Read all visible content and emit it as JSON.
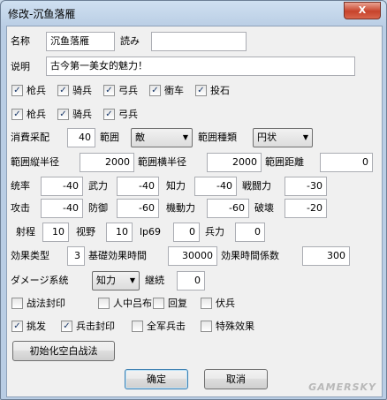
{
  "window": {
    "title": "修改-沉鱼落雁",
    "close_glyph": "X"
  },
  "name": {
    "label": "名称",
    "value": "沉鱼落雁",
    "reading_label": "読み",
    "reading_value": ""
  },
  "desc": {
    "label": "说明",
    "value": "古今第一美女的魅力！"
  },
  "unit_row1": [
    {
      "label": "枪兵",
      "checked": true
    },
    {
      "label": "骑兵",
      "checked": true
    },
    {
      "label": "弓兵",
      "checked": true
    },
    {
      "label": "衝车",
      "checked": true
    },
    {
      "label": "投石",
      "checked": true
    }
  ],
  "unit_row2": [
    {
      "label": "枪兵",
      "checked": true
    },
    {
      "label": "骑兵",
      "checked": true
    },
    {
      "label": "弓兵",
      "checked": true
    }
  ],
  "range": {
    "cost_label": "消費采配",
    "cost_value": "40",
    "scope_label": "範囲",
    "scope_value": "敵",
    "type_label": "範囲種類",
    "type_value": "円状"
  },
  "radius": {
    "v_label": "範囲縦半径",
    "v_value": "2000",
    "h_label": "範囲横半径",
    "h_value": "2000",
    "d_label": "範囲距離",
    "d_value": "0"
  },
  "stats1": [
    {
      "label": "统率",
      "value": "-40"
    },
    {
      "label": "武力",
      "value": "-40"
    },
    {
      "label": "知力",
      "value": "-40"
    },
    {
      "label": "戦闘力",
      "value": "-30"
    }
  ],
  "stats2": [
    {
      "label": "攻击",
      "value": "-40"
    },
    {
      "label": "防御",
      "value": "-60"
    },
    {
      "label": "機動力",
      "value": "-60"
    },
    {
      "label": "破壊",
      "value": "-20"
    }
  ],
  "misc": [
    {
      "label": "射程",
      "value": "10"
    },
    {
      "label": "视野",
      "value": "10"
    },
    {
      "label": "lp69",
      "value": "0"
    },
    {
      "label": "兵力",
      "value": "0"
    }
  ],
  "effect": {
    "type_label": "効果类型",
    "type_value": "3",
    "base_label": "基礎効果時間",
    "base_value": "30000",
    "coef_label": "効果時間係数",
    "coef_value": "300"
  },
  "damage": {
    "label": "ダメージ系统",
    "value": "知力",
    "cont_label": "継続",
    "cont_value": "0"
  },
  "flags_row1": [
    {
      "label": "战法封印",
      "checked": false
    },
    {
      "label": "人中吕布",
      "checked": false
    },
    {
      "label": "回复",
      "checked": false
    },
    {
      "label": "伏兵",
      "checked": false
    }
  ],
  "flags_row2": [
    {
      "label": "挑发",
      "checked": true
    },
    {
      "label": "兵击封印",
      "checked": true
    },
    {
      "label": "全军兵击",
      "checked": false
    },
    {
      "label": "特殊效果",
      "checked": false
    }
  ],
  "buttons": {
    "init": "初始化空白战法",
    "ok": "确定",
    "cancel": "取消"
  },
  "watermark": "GAMERSKY"
}
